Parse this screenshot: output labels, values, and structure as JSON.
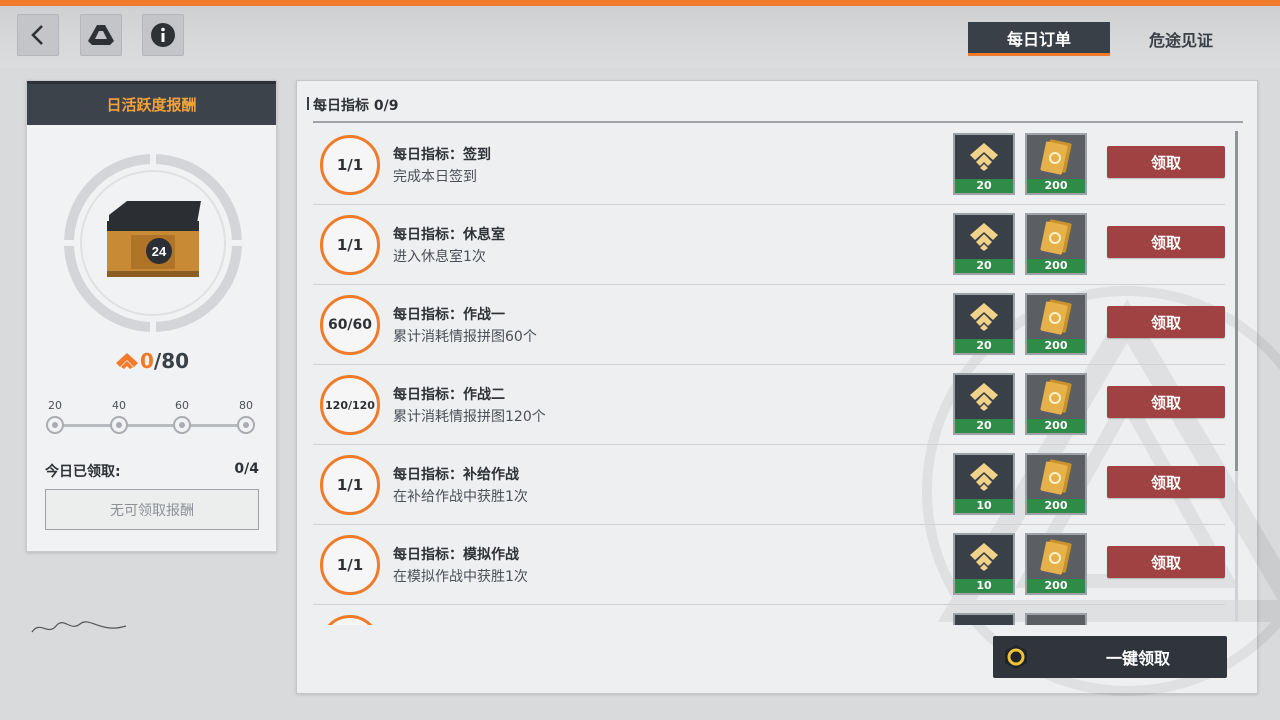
{
  "colors": {
    "accent": "#f07b2a",
    "claim": "#a04242",
    "dark": "#3a4047",
    "qty_green": "#2e8b48"
  },
  "topbar": {
    "back_icon": "chevron-left-icon",
    "drive_icon": "triangle-drive-icon",
    "info_icon": "info-icon"
  },
  "tabs": [
    {
      "label": "每日订单",
      "active": true
    },
    {
      "label": "危途见证",
      "active": false
    }
  ],
  "left_panel": {
    "title": "日活跃度报酬",
    "progress_current": "0",
    "progress_max": "/80",
    "milestones": [
      "20",
      "40",
      "60",
      "80"
    ],
    "today_label": "今日已领取:",
    "today_value": "0/4",
    "no_claim_label": "无可领取报酬"
  },
  "main": {
    "header": "每日指标 0/9",
    "claim_label": "领取",
    "one_key_label": "一键领取",
    "tasks": [
      {
        "progress": "1/1",
        "title": "每日指标：签到",
        "desc": "完成本日签到",
        "reward_a": "20",
        "reward_b": "200"
      },
      {
        "progress": "1/1",
        "title": "每日指标：休息室",
        "desc": "进入休息室1次",
        "reward_a": "20",
        "reward_b": "200"
      },
      {
        "progress": "60/60",
        "title": "每日指标：作战一",
        "desc": "累计消耗情报拼图60个",
        "reward_a": "20",
        "reward_b": "200"
      },
      {
        "progress": "120/120",
        "title": "每日指标：作战二",
        "desc": "累计消耗情报拼图120个",
        "reward_a": "20",
        "reward_b": "200"
      },
      {
        "progress": "1/1",
        "title": "每日指标：补给作战",
        "desc": "在补给作战中获胜1次",
        "reward_a": "10",
        "reward_b": "200"
      },
      {
        "progress": "1/1",
        "title": "每日指标：模拟作战",
        "desc": "在模拟作战中获胜1次",
        "reward_a": "10",
        "reward_b": "200"
      }
    ]
  }
}
